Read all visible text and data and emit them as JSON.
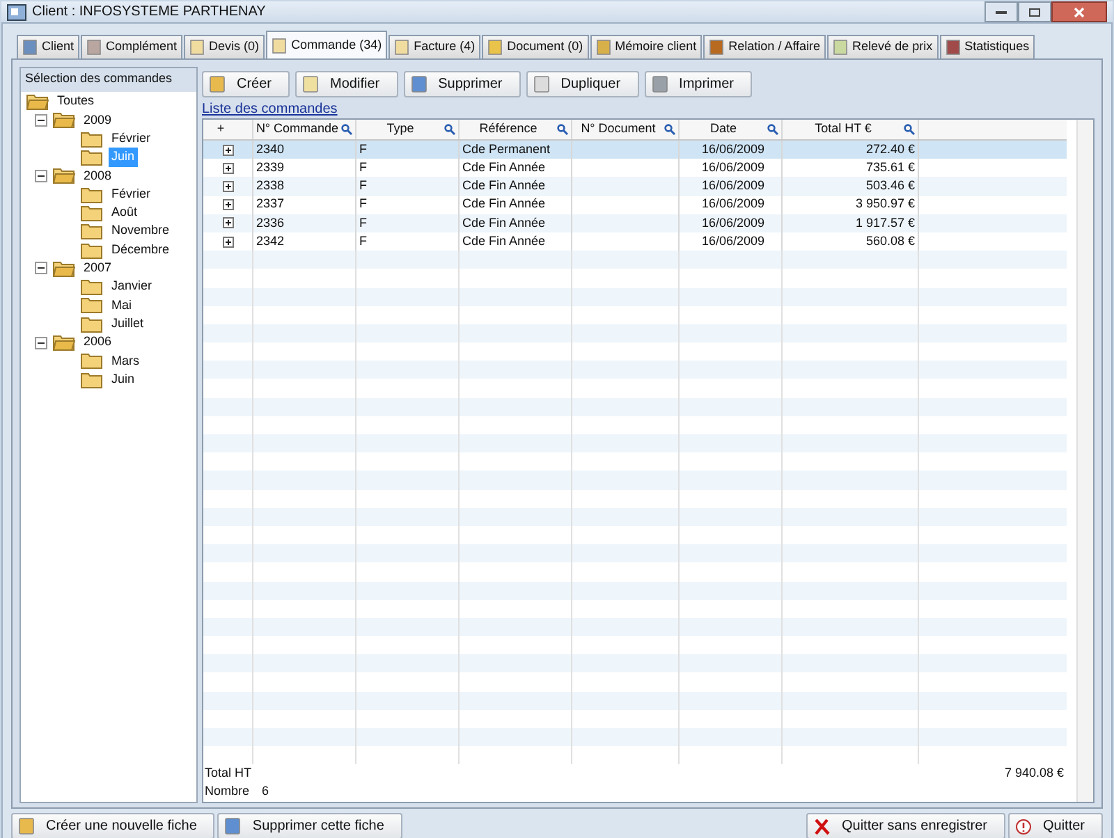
{
  "window": {
    "title": "Client : INFOSYSTEME PARTHENAY"
  },
  "tabs": [
    {
      "label": "Client",
      "selected": false
    },
    {
      "label": "Complément",
      "selected": false
    },
    {
      "label": "Devis (0)",
      "selected": false
    },
    {
      "label": "Commande (34)",
      "selected": true
    },
    {
      "label": "Facture (4)",
      "selected": false
    },
    {
      "label": "Document (0)",
      "selected": false
    },
    {
      "label": "Mémoire client",
      "selected": false
    },
    {
      "label": "Relation / Affaire",
      "selected": false
    },
    {
      "label": "Relevé de prix",
      "selected": false
    },
    {
      "label": "Statistiques",
      "selected": false
    }
  ],
  "tree": {
    "title": "Sélection des commandes",
    "root": {
      "label": "Toutes",
      "selected": false,
      "children": [
        {
          "label": "2009",
          "expanded": true,
          "selected": false,
          "children": [
            {
              "label": "Février",
              "selected": false
            },
            {
              "label": "Juin",
              "selected": true
            }
          ]
        },
        {
          "label": "2008",
          "expanded": true,
          "selected": false,
          "children": [
            {
              "label": "Février",
              "selected": false
            },
            {
              "label": "Août",
              "selected": false
            },
            {
              "label": "Novembre",
              "selected": false
            },
            {
              "label": "Décembre",
              "selected": false
            }
          ]
        },
        {
          "label": "2007",
          "expanded": true,
          "selected": false,
          "children": [
            {
              "label": "Janvier",
              "selected": false
            },
            {
              "label": "Mai",
              "selected": false
            },
            {
              "label": "Juillet",
              "selected": false
            }
          ]
        },
        {
          "label": "2006",
          "expanded": true,
          "selected": false,
          "children": [
            {
              "label": "Mars",
              "selected": false
            },
            {
              "label": "Juin",
              "selected": false
            }
          ]
        }
      ]
    }
  },
  "toolbar": [
    {
      "label": "Créer",
      "disabled": false
    },
    {
      "label": "Modifier",
      "disabled": false
    },
    {
      "label": "Supprimer",
      "disabled": false
    },
    {
      "label": "Dupliquer",
      "disabled": false
    },
    {
      "label": "Imprimer",
      "disabled": false
    }
  ],
  "list": {
    "title": "Liste des commandes",
    "columns": [
      {
        "label": "+",
        "search": false
      },
      {
        "label": "N° Commande",
        "search": true
      },
      {
        "label": "Type",
        "search": true
      },
      {
        "label": "Référence",
        "search": true
      },
      {
        "label": "N° Document",
        "search": true
      },
      {
        "label": "Date",
        "search": true
      },
      {
        "label": "Total HT €",
        "search": true
      }
    ],
    "rows": [
      {
        "cells": [
          "",
          "2340",
          "F",
          "Cde Permanent",
          "",
          "16/06/2009",
          "272.40 €"
        ],
        "selected": true
      },
      {
        "cells": [
          "",
          "2339",
          "F",
          "Cde Fin Année",
          "",
          "16/06/2009",
          "735.61 €"
        ],
        "selected": false
      },
      {
        "cells": [
          "",
          "2338",
          "F",
          "Cde Fin Année",
          "",
          "16/06/2009",
          "503.46 €"
        ],
        "selected": false
      },
      {
        "cells": [
          "",
          "2337",
          "F",
          "Cde Fin Année",
          "",
          "16/06/2009",
          "3 950.97 €"
        ],
        "selected": false
      },
      {
        "cells": [
          "",
          "2336",
          "F",
          "Cde Fin Année",
          "",
          "16/06/2009",
          "1 917.57 €"
        ],
        "selected": false
      },
      {
        "cells": [
          "",
          "2342",
          "F",
          "Cde Fin Année",
          "",
          "16/06/2009",
          "560.08 €"
        ],
        "selected": false
      }
    ],
    "total_label": "Total HT",
    "total_value": "7 940.08 €",
    "count_label": "Nombre",
    "count_value": "6"
  },
  "footer_left": [
    "Créer une nouvelle fiche",
    "Supprimer cette fiche"
  ],
  "footer_right": [
    "Quitter sans enregistrer",
    "Quitter"
  ]
}
